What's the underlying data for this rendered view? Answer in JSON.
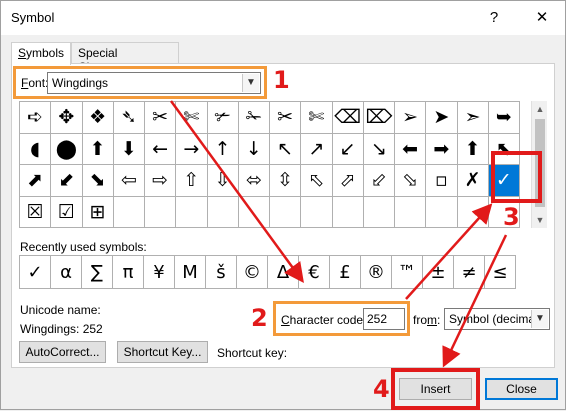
{
  "window": {
    "title": "Symbol",
    "help_glyph": "?",
    "close_glyph": "✕"
  },
  "tabs": [
    {
      "label_u": "S",
      "label_rest": "ymbols",
      "active": true
    },
    {
      "label_pre": "Special Characters",
      "active": false
    }
  ],
  "font": {
    "label_u": "F",
    "label_rest": "ont:",
    "value": "Wingdings"
  },
  "symbol_grid": {
    "cells": [
      "➪",
      "✥",
      "❖",
      "➴",
      "✂",
      "✄",
      "✃",
      "✁",
      "✂",
      "✄",
      "⌫",
      "⌦",
      "➢",
      "➤",
      "➣",
      "➥",
      "◖",
      "⬤",
      "⬆",
      "⬇",
      "←",
      "→",
      "↑",
      "↓",
      "↖",
      "↗",
      "↙",
      "↘",
      "⬅",
      "➡",
      "⬆",
      "⬉",
      "⬈",
      "⬋",
      "⬊",
      "⇦",
      "⇨",
      "⇧",
      "⇩",
      "⬄",
      "⇳",
      "⬁",
      "⬀",
      "⬃",
      "⬂",
      "▫",
      "✗",
      "✓",
      "☒",
      "☑",
      "⊞",
      "",
      "",
      "",
      "",
      "",
      "",
      "",
      "",
      "",
      "",
      "",
      "",
      ""
    ],
    "selected_index": 47
  },
  "recent": {
    "label": "Recently used symbols:",
    "symbols": [
      "✓",
      "α",
      "∑",
      "π",
      "¥",
      "M",
      "š",
      "©",
      "Δ",
      "€",
      "£",
      "®",
      "™",
      "±",
      "≠",
      "≤",
      "≥"
    ]
  },
  "unicode": {
    "name_label": "Unicode name:",
    "value": "Wingdings: 252"
  },
  "charcode": {
    "label_u": "C",
    "label_rest": "haracter code:",
    "value": "252",
    "from_label_u": "m",
    "from_label_pre": "fro",
    "from_label_post": ":",
    "from_value": "Symbol (decimal)"
  },
  "buttons": {
    "autocorrect": "AutoCorrect...",
    "shortcut_key": "Shortcut Key...",
    "insert": "Insert",
    "close": "Close"
  },
  "shortcut": {
    "label": "Shortcut key:"
  },
  "annotations": {
    "step1": "1",
    "step2": "2",
    "step3": "3",
    "step4": "4",
    "color": "#e11a1a",
    "highlight_color": "#f39a3a"
  }
}
